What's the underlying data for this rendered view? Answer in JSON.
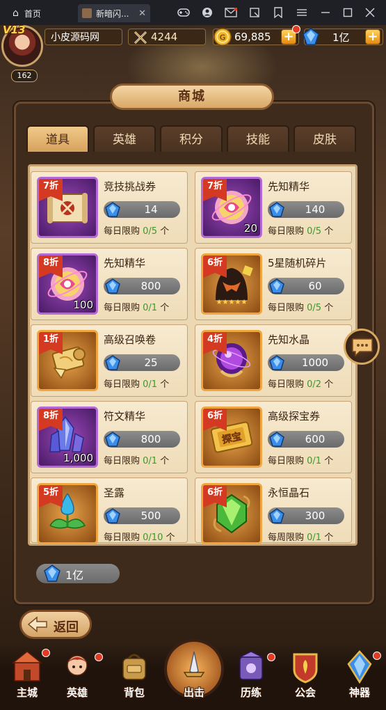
{
  "browser": {
    "tabs": [
      {
        "label": "首页",
        "icon": "home-icon"
      },
      {
        "label": "新暗闪...",
        "icon": "game-thumb-icon"
      }
    ],
    "controls": [
      "gamepad-icon",
      "user-icon",
      "mail-icon",
      "screenshot-icon",
      "menu-icon",
      "minimize-icon",
      "maximize-icon",
      "restore-icon",
      "close-icon"
    ]
  },
  "hud": {
    "vip": "V13",
    "level": "162",
    "player_name": "小皮源码网",
    "power": "4244",
    "gold": "69,885",
    "gems": "1亿",
    "plus": "+"
  },
  "shop": {
    "title": "商城",
    "tabs": [
      "道具",
      "英雄",
      "积分",
      "技能",
      "皮肤"
    ],
    "active_tab": 0,
    "items": [
      {
        "discount": "7折",
        "name": "竞技挑战券",
        "price": "14",
        "limit_label": "每日限购",
        "limit": "0/5",
        "unit": "个",
        "qty": "",
        "frame": "purple",
        "icon": "arena-ticket-icon"
      },
      {
        "discount": "7折",
        "name": "先知精华",
        "price": "140",
        "limit_label": "每日限购",
        "limit": "0/5",
        "unit": "个",
        "qty": "20",
        "frame": "purple",
        "icon": "prophet-essence-icon"
      },
      {
        "discount": "8折",
        "name": "先知精华",
        "price": "800",
        "limit_label": "每日限购",
        "limit": "0/1",
        "unit": "个",
        "qty": "100",
        "frame": "purple",
        "icon": "prophet-essence-icon"
      },
      {
        "discount": "6折",
        "name": "5星随机碎片",
        "price": "60",
        "limit_label": "每日限购",
        "limit": "0/5",
        "unit": "个",
        "qty": "",
        "frame": "orange",
        "icon": "hero-fragment-icon"
      },
      {
        "discount": "1折",
        "name": "高级召唤卷",
        "price": "25",
        "limit_label": "每日限购",
        "limit": "0/1",
        "unit": "个",
        "qty": "",
        "frame": "orange",
        "icon": "summon-scroll-icon"
      },
      {
        "discount": "4折",
        "name": "先知水晶",
        "price": "1000",
        "limit_label": "每日限购",
        "limit": "0/2",
        "unit": "个",
        "qty": "",
        "frame": "orange",
        "icon": "crystal-orb-icon"
      },
      {
        "discount": "8折",
        "name": "符文精华",
        "price": "800",
        "limit_label": "每日限购",
        "limit": "0/1",
        "unit": "个",
        "qty": "1,000",
        "frame": "purple",
        "icon": "rune-crystal-icon"
      },
      {
        "discount": "6折",
        "name": "高级探宝券",
        "price": "600",
        "limit_label": "每日限购",
        "limit": "0/1",
        "unit": "个",
        "qty": "",
        "frame": "orange",
        "icon": "treasure-ticket-icon"
      },
      {
        "discount": "5折",
        "name": "圣露",
        "price": "500",
        "limit_label": "每日限购",
        "limit": "0/10",
        "unit": "个",
        "qty": "",
        "frame": "orange",
        "icon": "holy-dew-icon"
      },
      {
        "discount": "6折",
        "name": "永恒晶石",
        "price": "300",
        "limit_label": "每周限购",
        "limit": "0/1",
        "unit": "个",
        "qty": "",
        "frame": "orange",
        "icon": "eternal-gem-icon"
      }
    ],
    "balance": "1亿",
    "treasure_ticket_text": "探宝",
    "back_label": "返回"
  },
  "nav": [
    {
      "label": "主城",
      "icon": "castle-icon",
      "dot": true
    },
    {
      "label": "英雄",
      "icon": "hero-icon",
      "dot": true
    },
    {
      "label": "背包",
      "icon": "backpack-icon",
      "dot": false
    },
    {
      "label": "出击",
      "icon": "sword-icon",
      "dot": false
    },
    {
      "label": "历练",
      "icon": "trial-icon",
      "dot": true
    },
    {
      "label": "公会",
      "icon": "guild-icon",
      "dot": false
    },
    {
      "label": "神器",
      "icon": "artifact-icon",
      "dot": true
    }
  ],
  "colors": {
    "discount": "#d43a22",
    "limit_count": "#3a9a2a",
    "gold_accent": "#f0c98a"
  }
}
